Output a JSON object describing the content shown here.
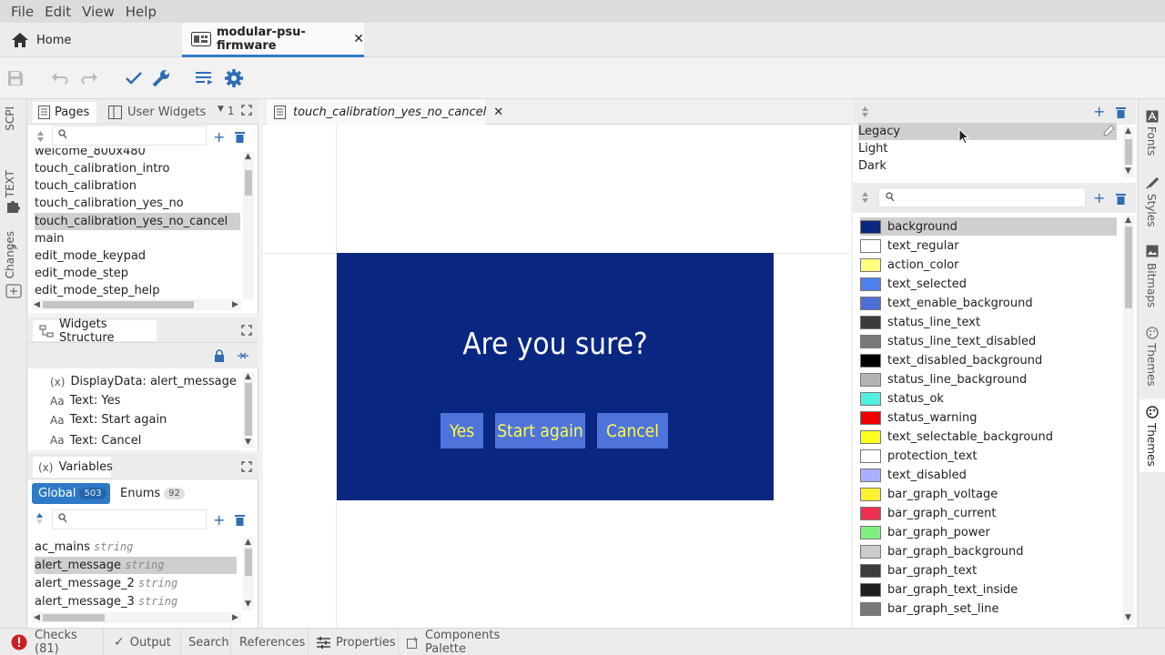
{
  "menubar": {
    "items": [
      "File",
      "Edit",
      "View",
      "Help"
    ]
  },
  "tabs": {
    "home": "Home",
    "project": "modular-psu-firmware"
  },
  "pages_panel": {
    "tab_pages": "Pages",
    "tab_user_widgets": "User Widgets",
    "dropdown_value": "1",
    "items": [
      "welcome_800x480",
      "touch_calibration_intro",
      "touch_calibration",
      "touch_calibration_yes_no",
      "touch_calibration_yes_no_cancel",
      "main",
      "edit_mode_keypad",
      "edit_mode_step",
      "edit_mode_step_help"
    ],
    "selected_index": 4
  },
  "widgets_panel": {
    "title": "Widgets Structure",
    "items": [
      "DisplayData: alert_message",
      "Text: Yes",
      "Text: Start again",
      "Text: Cancel"
    ]
  },
  "variables_panel": {
    "title": "Variables",
    "tab_global": "Global",
    "global_count": "503",
    "tab_enums": "Enums",
    "enums_count": "92",
    "items": [
      {
        "name": "ac_mains",
        "type": "string"
      },
      {
        "name": "alert_message",
        "type": "string"
      },
      {
        "name": "alert_message_2",
        "type": "string"
      },
      {
        "name": "alert_message_3",
        "type": "string"
      }
    ]
  },
  "left_strip": {
    "tabs": [
      "SCPI",
      "TEXT",
      "Changes"
    ]
  },
  "editor": {
    "tab_title": "touch_calibration_yes_no_cancel",
    "dialog": {
      "title": "Are you sure?",
      "buttons": [
        "Yes",
        "Start again",
        "Cancel"
      ],
      "bg_color": "#092781",
      "button_color": "#4e74dc",
      "text_color": "#fbfb4e"
    }
  },
  "themes_panel": {
    "items": [
      "Legacy",
      "Light",
      "Dark"
    ]
  },
  "colors_panel": {
    "items": [
      {
        "name": "background",
        "color": "#092781"
      },
      {
        "name": "text_regular",
        "color": "#ffffff"
      },
      {
        "name": "action_color",
        "color": "#ffff80"
      },
      {
        "name": "text_selected",
        "color": "#4f80f0"
      },
      {
        "name": "text_enable_background",
        "color": "#4e6fd8"
      },
      {
        "name": "status_line_text",
        "color": "#3c3c3c"
      },
      {
        "name": "status_line_text_disabled",
        "color": "#7a7a7a"
      },
      {
        "name": "text_disabled_background",
        "color": "#000000"
      },
      {
        "name": "status_line_background",
        "color": "#b4b4b4"
      },
      {
        "name": "status_ok",
        "color": "#50f0e0"
      },
      {
        "name": "status_warning",
        "color": "#f00000"
      },
      {
        "name": "text_selectable_background",
        "color": "#ffff20"
      },
      {
        "name": "protection_text",
        "color": "#ffffff"
      },
      {
        "name": "text_disabled",
        "color": "#aab0ff"
      },
      {
        "name": "bar_graph_voltage",
        "color": "#fff030"
      },
      {
        "name": "bar_graph_current",
        "color": "#f03050"
      },
      {
        "name": "bar_graph_power",
        "color": "#80f080"
      },
      {
        "name": "bar_graph_background",
        "color": "#cccccc"
      },
      {
        "name": "bar_graph_text",
        "color": "#3c3c3c"
      },
      {
        "name": "bar_graph_text_inside",
        "color": "#202020"
      },
      {
        "name": "bar_graph_set_line",
        "color": "#787878"
      }
    ]
  },
  "right_strip": {
    "tabs": [
      "Fonts",
      "Styles",
      "Bitmaps",
      "Themes",
      "Themes"
    ]
  },
  "statusbar": {
    "checks": "Checks (81)",
    "output": "Output",
    "search": "Search",
    "references": "References",
    "properties": "Properties",
    "components": "Components Palette"
  }
}
